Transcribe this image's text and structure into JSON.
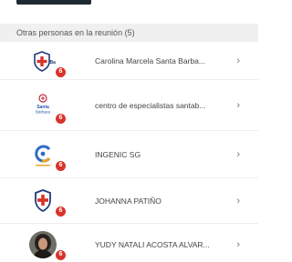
{
  "section": {
    "title": "Otras personas en la reunión (5)"
  },
  "participants": [
    {
      "name": "Carolina Marcela Santa Barba...",
      "badge": "6",
      "avatar_icon": "shield-cross-logo-icon"
    },
    {
      "name": "centro de especialistas santab...",
      "badge": "6",
      "avatar_icon": "santa-barbara-logo-icon"
    },
    {
      "name": "INGENIC SG",
      "badge": "6",
      "avatar_icon": "ingenic-logo-icon"
    },
    {
      "name": "JOHANNA PATIÑO",
      "badge": "6",
      "avatar_icon": "shield-cross-logo-icon"
    },
    {
      "name": "YUDY NATALI ACOSTA ALVAR...",
      "badge": "6",
      "avatar_icon": "person-photo-icon"
    }
  ],
  "chevron": "›",
  "colors": {
    "badge": "#d7342b",
    "header_bg": "#f0f0f0"
  }
}
